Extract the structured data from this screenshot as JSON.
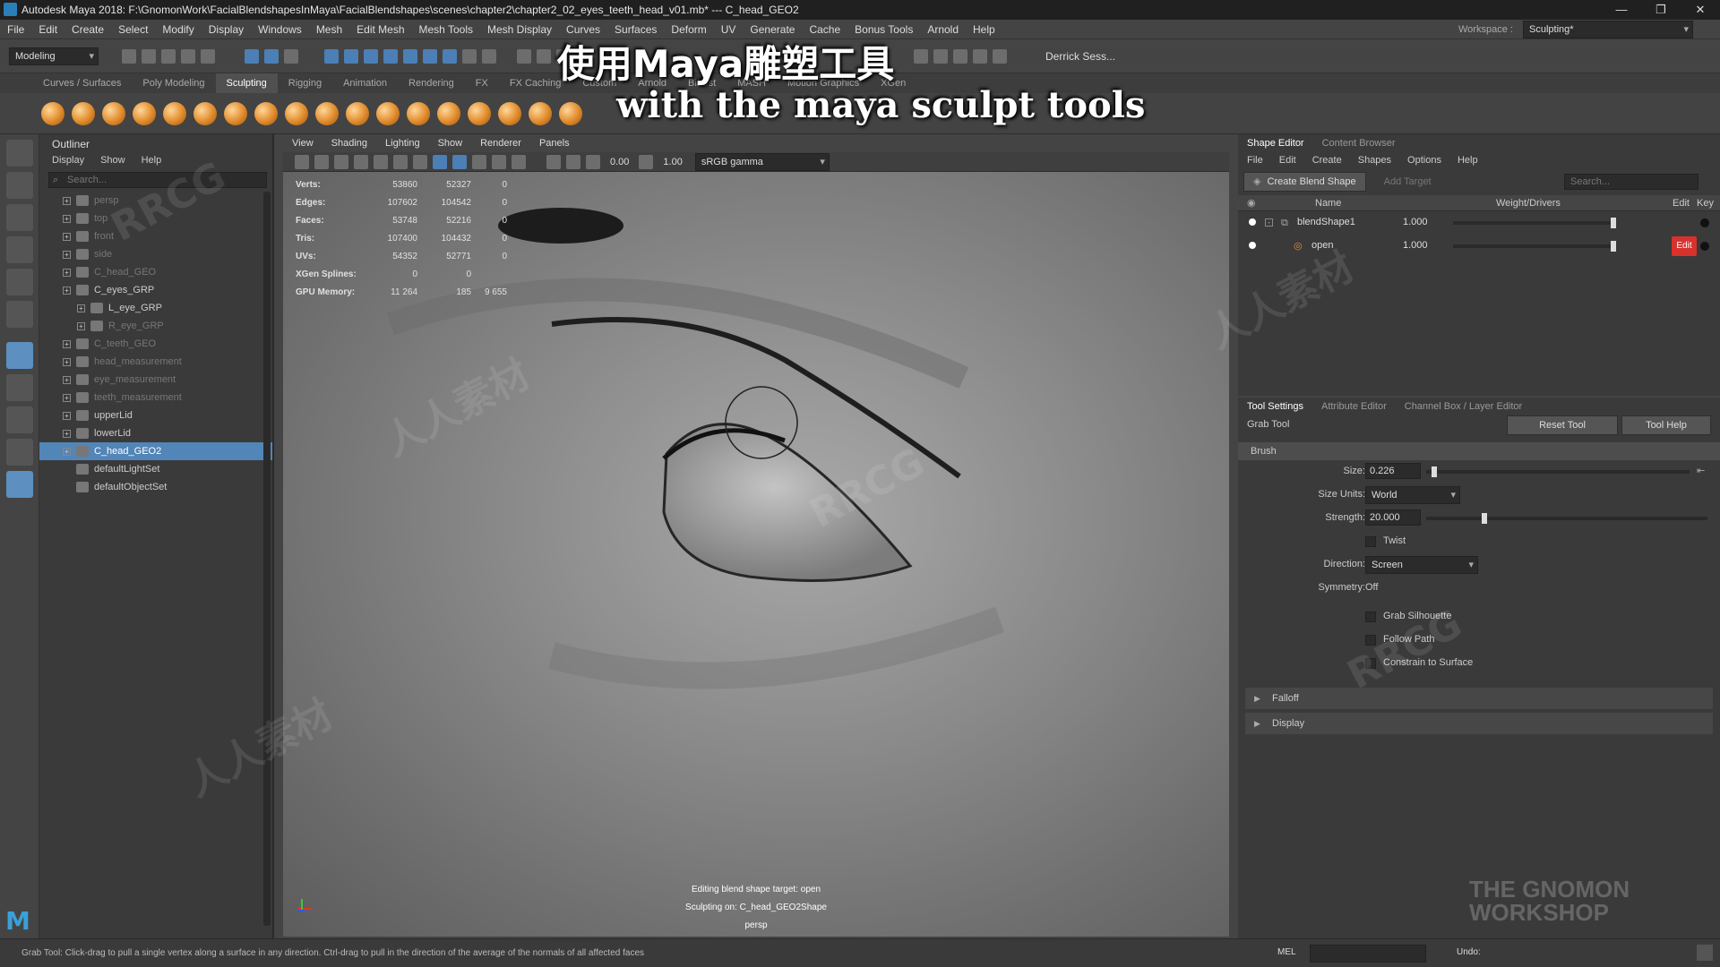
{
  "titlebar": {
    "title": "Autodesk Maya 2018: F:\\GnomonWork\\FacialBlendshapesInMaya\\FacialBlendshapes\\scenes\\chapter2\\chapter2_02_eyes_teeth_head_v01.mb*   ---   C_head_GEO2",
    "minimize": "—",
    "restore": "❐",
    "close": "✕"
  },
  "menubar": [
    "File",
    "Edit",
    "Create",
    "Select",
    "Modify",
    "Display",
    "Windows",
    "Mesh",
    "Edit Mesh",
    "Mesh Tools",
    "Mesh Display",
    "Curves",
    "Surfaces",
    "Deform",
    "UV",
    "Generate",
    "Cache",
    "Bonus Tools",
    "Arnold",
    "Help"
  ],
  "workspace": {
    "label": "Workspace :",
    "value": "Sculpting*"
  },
  "statusline": {
    "mode": "Modeling",
    "user": "Derrick Sess..."
  },
  "shelf": {
    "tabs": [
      "Curves / Surfaces",
      "Poly Modeling",
      "Sculpting",
      "Rigging",
      "Animation",
      "Rendering",
      "FX",
      "FX Caching",
      "Custom",
      "Arnold",
      "Bifrost",
      "MASH",
      "Motion Graphics",
      "XGen"
    ],
    "active": "Sculpting",
    "tool_count": 18
  },
  "subtitle": {
    "zh": "使用Maya雕塑工具",
    "en": "with the maya sculpt tools"
  },
  "outliner": {
    "title": "Outliner",
    "menu": [
      "Display",
      "Show",
      "Help"
    ],
    "search_placeholder": "Search...",
    "items": [
      {
        "label": "persp",
        "dim": true
      },
      {
        "label": "top",
        "dim": true
      },
      {
        "label": "front",
        "dim": true
      },
      {
        "label": "side",
        "dim": true
      },
      {
        "label": "C_head_GEO",
        "dim": true
      },
      {
        "label": "C_eyes_GRP",
        "dim": false
      },
      {
        "label": "L_eye_GRP",
        "dim": false
      },
      {
        "label": "R_eye_GRP",
        "dim": true
      },
      {
        "label": "C_teeth_GEO",
        "dim": true
      },
      {
        "label": "head_measurement",
        "dim": true
      },
      {
        "label": "eye_measurement",
        "dim": true
      },
      {
        "label": "teeth_measurement",
        "dim": true
      },
      {
        "label": "upperLid",
        "dim": false
      },
      {
        "label": "lowerLid",
        "dim": false
      },
      {
        "label": "C_head_GEO2",
        "dim": false,
        "selected": true
      },
      {
        "label": "defaultLightSet",
        "dim": false
      },
      {
        "label": "defaultObjectSet",
        "dim": false
      }
    ]
  },
  "viewport": {
    "menu": [
      "View",
      "Shading",
      "Lighting",
      "Show",
      "Renderer",
      "Panels"
    ],
    "exposure": "0.00",
    "gamma": "1.00",
    "colorspace": "sRGB gamma",
    "hud": [
      {
        "label": "Verts:",
        "a": "53860",
        "b": "52327",
        "c": "0"
      },
      {
        "label": "Edges:",
        "a": "107602",
        "b": "104542",
        "c": "0"
      },
      {
        "label": "Faces:",
        "a": "53748",
        "b": "52216",
        "c": "0"
      },
      {
        "label": "Tris:",
        "a": "107400",
        "b": "104432",
        "c": "0"
      },
      {
        "label": "UVs:",
        "a": "54352",
        "b": "52771",
        "c": "0"
      },
      {
        "label": "XGen Splines:",
        "a": "0",
        "b": "0",
        "c": ""
      },
      {
        "label": "GPU Memory:",
        "a": "11 264",
        "b": "185",
        "c": "9 655"
      }
    ],
    "footer": {
      "line1": "Editing blend shape target: open",
      "line2": "Sculpting on: C_head_GEO2Shape",
      "camera": "persp"
    }
  },
  "shape_editor": {
    "tabs": [
      "Shape Editor",
      "Content Browser"
    ],
    "menu": [
      "File",
      "Edit",
      "Create",
      "Shapes",
      "Options",
      "Help"
    ],
    "create_btn": "Create Blend Shape",
    "add_target_btn": "Add Target",
    "search_placeholder": "Search...",
    "columns": {
      "name": "Name",
      "weight": "Weight/Drivers",
      "edit": "Edit",
      "key": "Key"
    },
    "rows": [
      {
        "name": "blendShape1",
        "weight": "1.000",
        "weight_fraction": 1.0,
        "edit": ""
      },
      {
        "name": "open",
        "weight": "1.000",
        "weight_fraction": 1.0,
        "edit": "Edit"
      }
    ]
  },
  "tool_settings": {
    "tabs": [
      "Tool Settings",
      "Attribute Editor",
      "Channel Box / Layer Editor"
    ],
    "tool_name": "Grab Tool",
    "reset_btn": "Reset Tool",
    "help_btn": "Tool Help",
    "section": "Brush",
    "size": {
      "label": "Size:",
      "value": "0.226",
      "fraction": 0.02
    },
    "size_units": {
      "label": "Size Units:",
      "value": "World"
    },
    "strength": {
      "label": "Strength:",
      "value": "20.000",
      "fraction": 0.2
    },
    "twist": "Twist",
    "direction": {
      "label": "Direction:",
      "value": "Screen"
    },
    "symmetry": {
      "label": "Symmetry:",
      "value": "Off"
    },
    "checks": [
      "Grab Silhouette",
      "Follow Path",
      "Constrain to Surface"
    ],
    "collapsed": [
      "Falloff",
      "Display"
    ]
  },
  "helpline": {
    "text": "Grab Tool: Click-drag to pull a single vertex along a surface in any direction. Ctrl-drag to pull in the direction of the average of the normals of all affected faces",
    "mel": "MEL",
    "undo": "Undo:"
  },
  "watermarks": {
    "a": "RRCG",
    "b": "人人素材",
    "brand": "THE GNOMON WORKSHOP"
  }
}
